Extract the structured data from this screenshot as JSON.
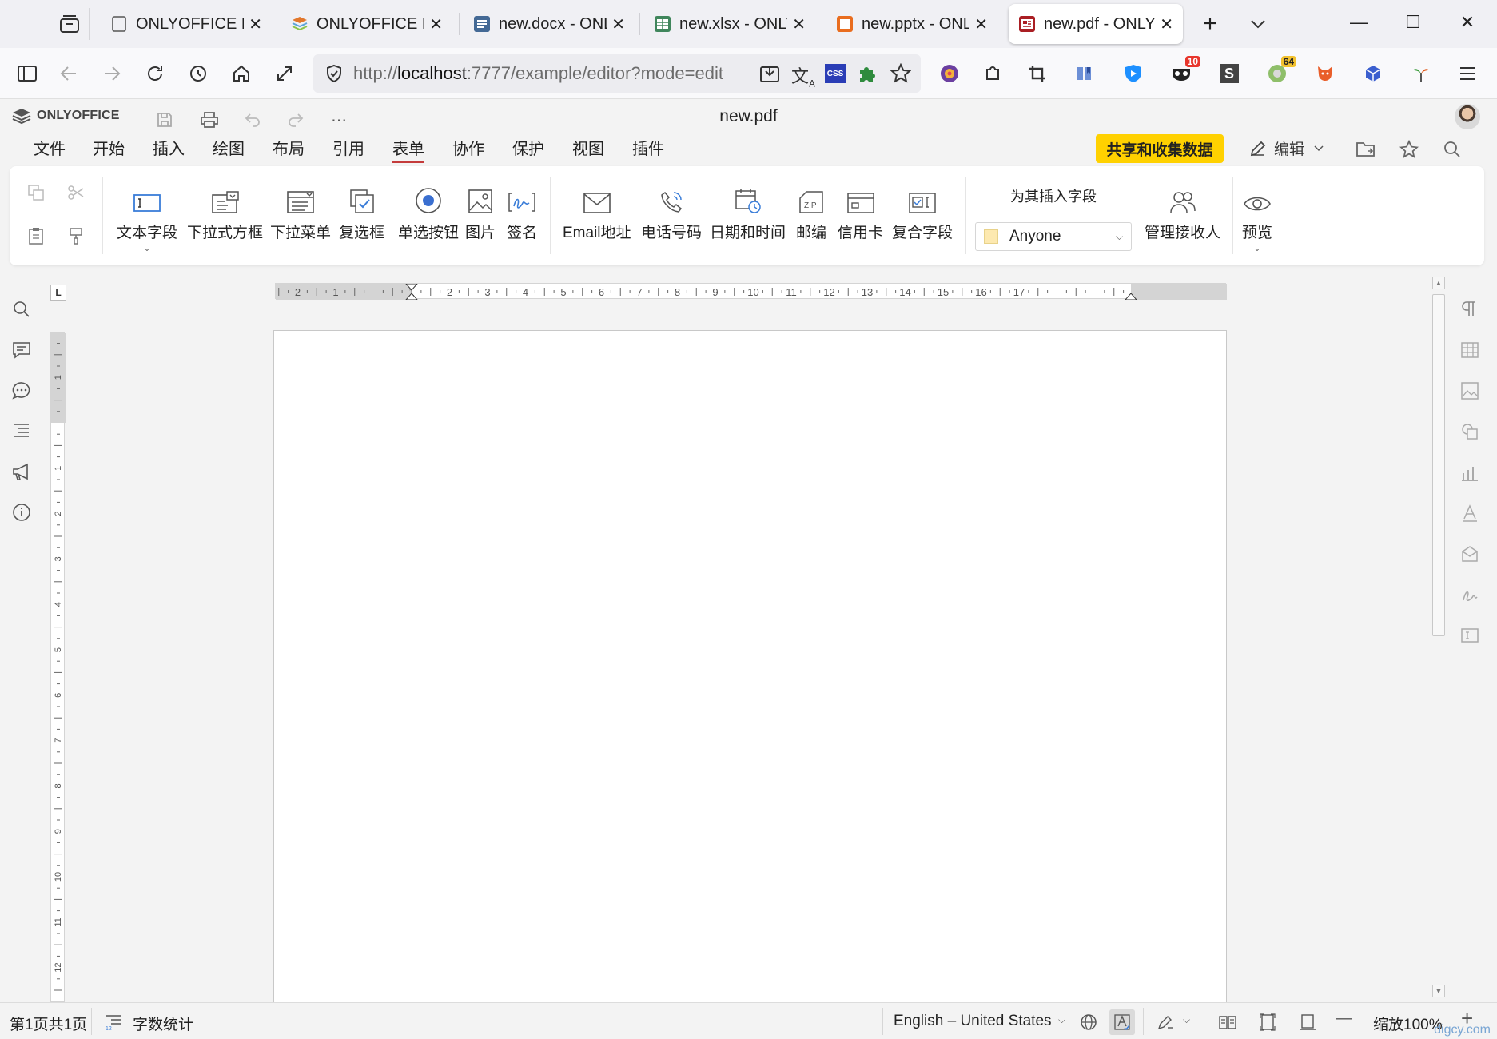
{
  "browser": {
    "tabs": [
      {
        "title": "ONLYOFFICE Docs C",
        "color": "#555555"
      },
      {
        "title": "ONLYOFFICE Do",
        "color": "#e2772b"
      },
      {
        "title": "new.docx - ONLY",
        "color": "#446995"
      },
      {
        "title": "new.xlsx - ONLY(",
        "color": "#40865c"
      },
      {
        "title": "new.pptx - ONLY",
        "color": "#be6532"
      },
      {
        "title": "new.pdf - ONLY(",
        "color": "#aa5252"
      }
    ],
    "close_glyph": "✕",
    "new_tab_glyph": "+",
    "list_tabs_glyph": "⌄",
    "window": {
      "minimize": "—",
      "maximize": "☐",
      "close": "✕"
    },
    "url": {
      "prefix": "http://",
      "host": "localhost",
      "rest": ":7777/example/editor?mode=edit"
    },
    "extension_badges": {
      "first": "10",
      "second": "64"
    },
    "css_label": "CSS",
    "s_label": "S"
  },
  "app": {
    "logo_text": "ONLYOFFICE",
    "doc_title": "new.pdf",
    "menu": [
      "文件",
      "开始",
      "插入",
      "绘图",
      "布局",
      "引用",
      "表单",
      "协作",
      "保护",
      "视图",
      "插件"
    ],
    "active_menu": "表单",
    "share_button": "共享和收集数据",
    "edit_button": "编辑"
  },
  "ribbon": {
    "buttons": [
      {
        "label": "文本字段",
        "icon": "text-field-icon"
      },
      {
        "label": "下拉式方框",
        "icon": "combo-box-icon"
      },
      {
        "label": "下拉菜单",
        "icon": "dropdown-icon"
      },
      {
        "label": "复选框",
        "icon": "checkbox-icon"
      },
      {
        "label": "单选按钮",
        "icon": "radio-icon"
      },
      {
        "label": "图片",
        "icon": "image-icon"
      },
      {
        "label": "签名",
        "icon": "signature-icon"
      },
      {
        "label": "Email地址",
        "icon": "email-icon"
      },
      {
        "label": "电话号码",
        "icon": "phone-icon"
      },
      {
        "label": "日期和时间",
        "icon": "datetime-icon"
      },
      {
        "label": "邮编",
        "icon": "zip-icon"
      },
      {
        "label": "信用卡",
        "icon": "credit-card-icon"
      },
      {
        "label": "复合字段",
        "icon": "complex-field-icon"
      }
    ],
    "insert_fields_for": "为其插入字段",
    "recipient": "Anyone",
    "manage_recipients": "管理接收人",
    "preview": "预览"
  },
  "ruler": {
    "tab_stop": "L",
    "h_numbers": [
      "2",
      "1",
      "",
      "1",
      "2",
      "3",
      "4",
      "5",
      "6",
      "7",
      "8",
      "9",
      "10",
      "11",
      "12",
      "13",
      "14",
      "15",
      "16",
      "17"
    ],
    "v_numbers": [
      "1",
      "",
      "1",
      "2",
      "3",
      "4",
      "5",
      "6",
      "7",
      "8",
      "9",
      "10",
      "11",
      "12"
    ]
  },
  "status": {
    "page": "第1页共1页",
    "word_count": "字数统计",
    "language": "English – United States",
    "zoom": "缩放100%",
    "zoom_out": "—",
    "zoom_in": "+"
  },
  "watermark": "digcy.com"
}
